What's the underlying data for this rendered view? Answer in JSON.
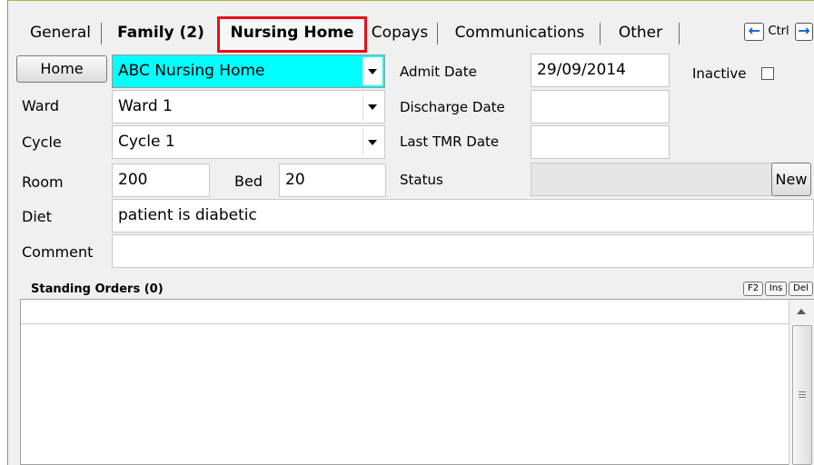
{
  "tabs": [
    {
      "label": "General"
    },
    {
      "label": "Family (2)"
    },
    {
      "label": "Nursing Home"
    },
    {
      "label": "Copays"
    },
    {
      "label": "Communications"
    },
    {
      "label": "Other"
    }
  ],
  "nav": {
    "ctrl_label": "Ctrl"
  },
  "form": {
    "home_button": "Home",
    "home_value": "ABC Nursing Home",
    "ward_label": "Ward",
    "ward_value": "Ward 1",
    "cycle_label": "Cycle",
    "cycle_value": "Cycle 1",
    "room_label": "Room",
    "room_value": "200",
    "bed_label": "Bed",
    "bed_value": "20",
    "diet_label": "Diet",
    "diet_value": "patient is diabetic",
    "comment_label": "Comment",
    "comment_value": "",
    "admit_date_label": "Admit Date",
    "admit_date_value": "29/09/2014",
    "discharge_date_label": "Discharge Date",
    "discharge_date_value": "",
    "last_tmr_label": "Last TMR Date",
    "last_tmr_value": "",
    "status_label": "Status",
    "status_value": "",
    "new_button": "New",
    "inactive_label": "Inactive"
  },
  "standing_orders": {
    "title": "Standing Orders (0)",
    "keys": [
      "F2",
      "Ins",
      "Del"
    ]
  },
  "colors": {
    "highlight": "#00ffff",
    "active_tab_border": "#e8101c"
  }
}
